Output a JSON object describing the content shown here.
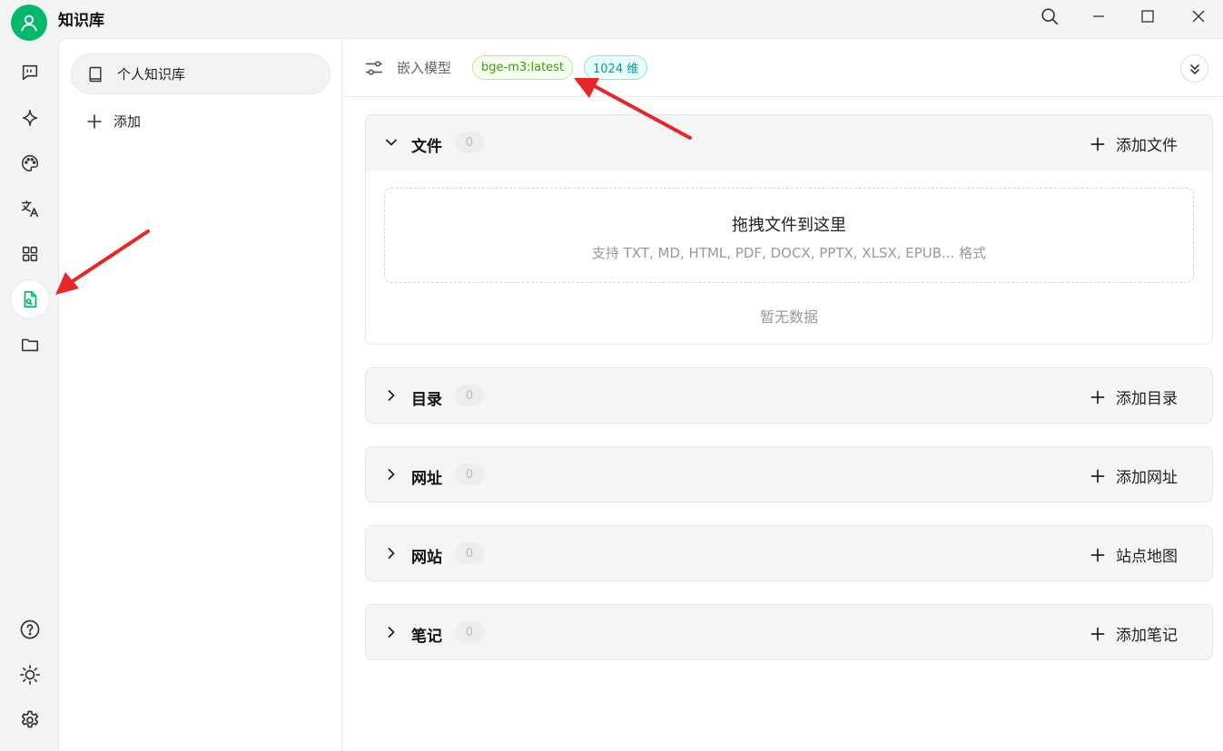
{
  "app": {
    "title": "知识库"
  },
  "knowledge_list": {
    "items": [
      {
        "label": "个人知识库"
      }
    ],
    "add_label": "添加"
  },
  "header": {
    "embed_label": "嵌入模型",
    "model_tag": "bge-m3:latest",
    "dimension_tag": "1024 维"
  },
  "sections": [
    {
      "title": "文件",
      "count": "0",
      "add_label": "添加文件",
      "expanded": true
    },
    {
      "title": "目录",
      "count": "0",
      "add_label": "添加目录",
      "expanded": false
    },
    {
      "title": "网址",
      "count": "0",
      "add_label": "添加网址",
      "expanded": false
    },
    {
      "title": "网站",
      "count": "0",
      "add_label": "站点地图",
      "expanded": false
    },
    {
      "title": "笔记",
      "count": "0",
      "add_label": "添加笔记",
      "expanded": false
    }
  ],
  "dropzone": {
    "title": "拖拽文件到这里",
    "subtitle": "支持 TXT, MD, HTML, PDF, DOCX, PPTX, XLSX, EPUB... 格式",
    "empty_text": "暂无数据"
  },
  "colors": {
    "accent": "#00b96b",
    "arrow": "#e8262a"
  },
  "icons": {
    "rail": [
      "chat-icon",
      "sparkle-icon",
      "palette-icon",
      "translate-icon",
      "apps-grid-icon",
      "knowledge-file-icon",
      "folder-icon",
      "help-icon",
      "theme-sun-icon",
      "settings-gear-icon"
    ]
  }
}
